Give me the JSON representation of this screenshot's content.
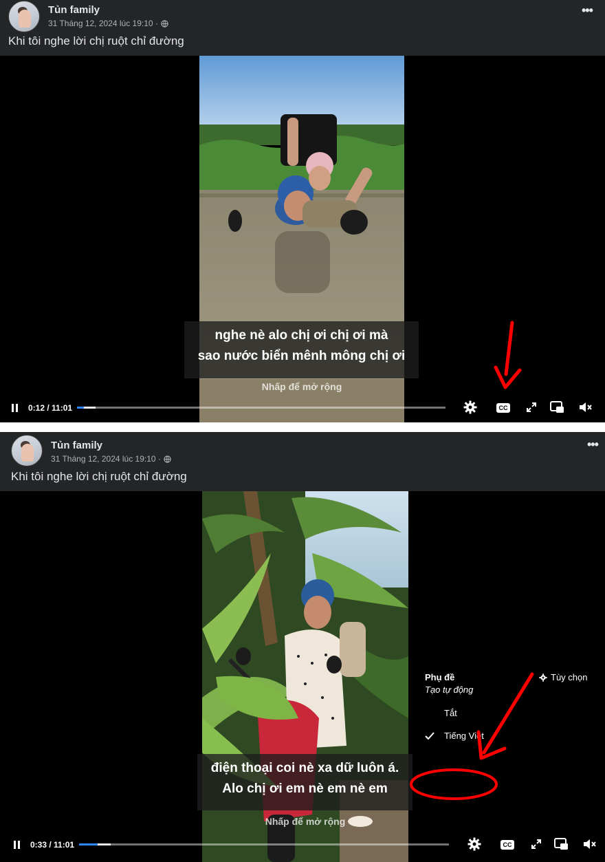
{
  "posts": [
    {
      "author": "Tủn family",
      "date": "31 Tháng 12, 2024 lúc 19:10 ·",
      "more": "•••",
      "caption": "Khi tôi nghe lời chị ruột chỉ đường",
      "video": {
        "subtitle_line1": "nghe nè alo chị ơi chị ơi mà",
        "subtitle_line2": "sao nước biển mênh mông chị ơi",
        "expand_hint": "Nhấp để mở rộng",
        "time": "0:12 / 11:01",
        "progress": 0.018,
        "buffered": 0.05,
        "cc_label": "CC"
      }
    },
    {
      "author": "Tủn family",
      "date": "31 Tháng 12, 2024 lúc 19:10 ·",
      "more": "•••",
      "caption": "Khi tôi nghe lời chị ruột chỉ đường",
      "video": {
        "subtitle_line1": "điện thoại coi nè xa dữ luôn á.",
        "subtitle_line2": "Alo chị ơi em nè em nè em",
        "expand_hint": "Nhấp để mở rộng",
        "time": "0:33 / 11:01",
        "progress": 0.05,
        "buffered": 0.085,
        "cc_label": "CC",
        "captions_menu": {
          "title": "Phụ đề",
          "subtitle": "Tạo tự động",
          "options_label": "Tùy chọn",
          "off_label": "Tắt",
          "selected_label": "Tiếng Việt"
        }
      }
    }
  ],
  "colors": {
    "post_bg": "#242526",
    "accent": "#2d88ff",
    "annotation": "#ff0000"
  }
}
